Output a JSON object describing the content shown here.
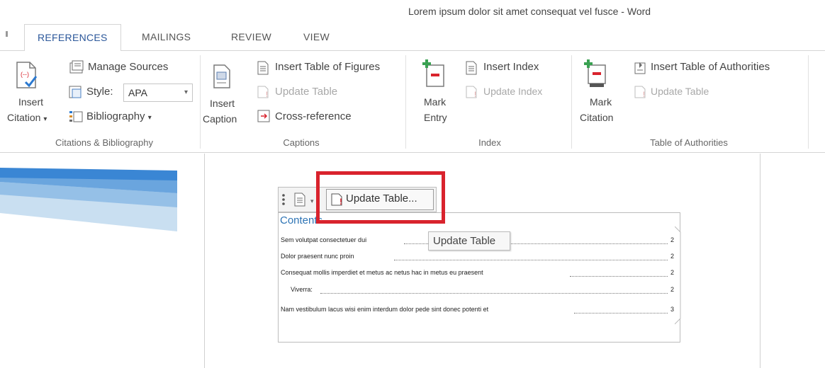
{
  "window": {
    "title": "Lorem ipsum dolor sit amet consequat vel fusce - Word"
  },
  "tabs": [
    {
      "label": "REFERENCES",
      "active": true
    },
    {
      "label": "MAILINGS",
      "active": false
    },
    {
      "label": "REVIEW",
      "active": false
    },
    {
      "label": "VIEW",
      "active": false
    }
  ],
  "ribbon": {
    "citations": {
      "insert_citation": [
        "Insert",
        "Citation"
      ],
      "dropdown_arrow": "▾",
      "manage_sources": "Manage Sources",
      "style_label": "Style:",
      "style_value": "APA",
      "bibliography": "Bibliography",
      "group_label": "Citations & Bibliography"
    },
    "captions": {
      "insert_caption": [
        "Insert",
        "Caption"
      ],
      "insert_table_of_figures": "Insert Table of Figures",
      "update_table": "Update Table",
      "cross_reference": "Cross-reference",
      "group_label": "Captions"
    },
    "index": {
      "mark_entry": [
        "Mark",
        "Entry"
      ],
      "insert_index": "Insert Index",
      "update_index": "Update Index",
      "group_label": "Index"
    },
    "authorities": {
      "mark_citation": [
        "Mark",
        "Citation"
      ],
      "insert_table_of_authorities": "Insert Table of Authorities",
      "update_table": "Update Table",
      "group_label": "Table of Authorities"
    }
  },
  "document": {
    "toc_button": "Update Table...",
    "toc_title": "Contents",
    "tooltip": "Update Table",
    "toc_entries": [
      {
        "text": "Sem volutpat consectetuer dui",
        "page": "2",
        "indent": false
      },
      {
        "text": "Dolor praesent nunc proin",
        "page": "2",
        "indent": false
      },
      {
        "text": "Consequat mollis imperdiet et metus ac netus hac in metus eu praesent",
        "page": "2",
        "indent": false
      },
      {
        "text": "Viverra:",
        "page": "2",
        "indent": true
      },
      {
        "text": "Nam vestibulum lacus wisi enim interdum dolor pede sint donec potenti et",
        "page": "3",
        "indent": false
      }
    ]
  },
  "colors": {
    "accent": "#2b579a",
    "highlight": "#d9232d",
    "heading": "#2e74b5",
    "thumbnail_dark": "#3a86d4",
    "thumbnail_light": "#c9dff1"
  }
}
